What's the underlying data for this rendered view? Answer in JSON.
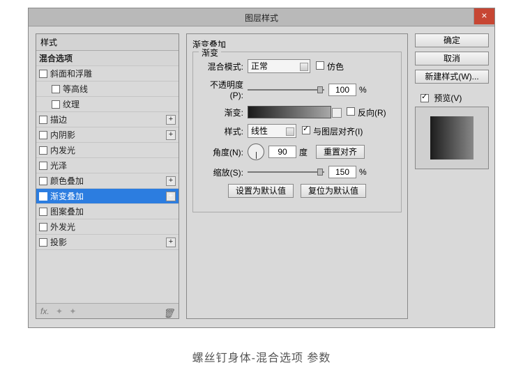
{
  "window": {
    "title": "图层样式"
  },
  "close_label": "×",
  "left_header": "样式",
  "styles": [
    {
      "label": "混合选项",
      "header": true
    },
    {
      "label": "斜面和浮雕",
      "checked": false,
      "plus": false
    },
    {
      "label": "等高线",
      "checked": false,
      "indent": true
    },
    {
      "label": "纹理",
      "checked": false,
      "indent": true
    },
    {
      "label": "描边",
      "checked": false,
      "plus": true
    },
    {
      "label": "内阴影",
      "checked": false,
      "plus": true
    },
    {
      "label": "内发光",
      "checked": false
    },
    {
      "label": "光泽",
      "checked": false
    },
    {
      "label": "颜色叠加",
      "checked": false,
      "plus": true
    },
    {
      "label": "渐变叠加",
      "checked": true,
      "plus": true,
      "selected": true
    },
    {
      "label": "图案叠加",
      "checked": false
    },
    {
      "label": "外发光",
      "checked": false
    },
    {
      "label": "投影",
      "checked": false,
      "plus": true
    }
  ],
  "footer_fx": "fx.",
  "panel": {
    "title": "渐变叠加",
    "group": "渐变",
    "blend_mode_label": "混合模式:",
    "blend_mode_value": "正常",
    "dither_label": "仿色",
    "opacity_label": "不透明度(P):",
    "opacity_value": "100",
    "opacity_unit": "%",
    "gradient_label": "渐变:",
    "reverse_label": "反向(R)",
    "style_label": "样式:",
    "style_value": "线性",
    "align_label": "与图层对齐(I)",
    "angle_label": "角度(N):",
    "angle_value": "90",
    "angle_unit": "度",
    "reset_align": "重置对齐",
    "scale_label": "缩放(S):",
    "scale_value": "150",
    "scale_unit": "%",
    "make_default": "设置为默认值",
    "reset_default": "复位为默认值"
  },
  "right": {
    "ok": "确定",
    "cancel": "取消",
    "new_style": "新建样式(W)...",
    "preview": "预览(V)"
  },
  "caption": "螺丝钉身体-混合选项 参数"
}
